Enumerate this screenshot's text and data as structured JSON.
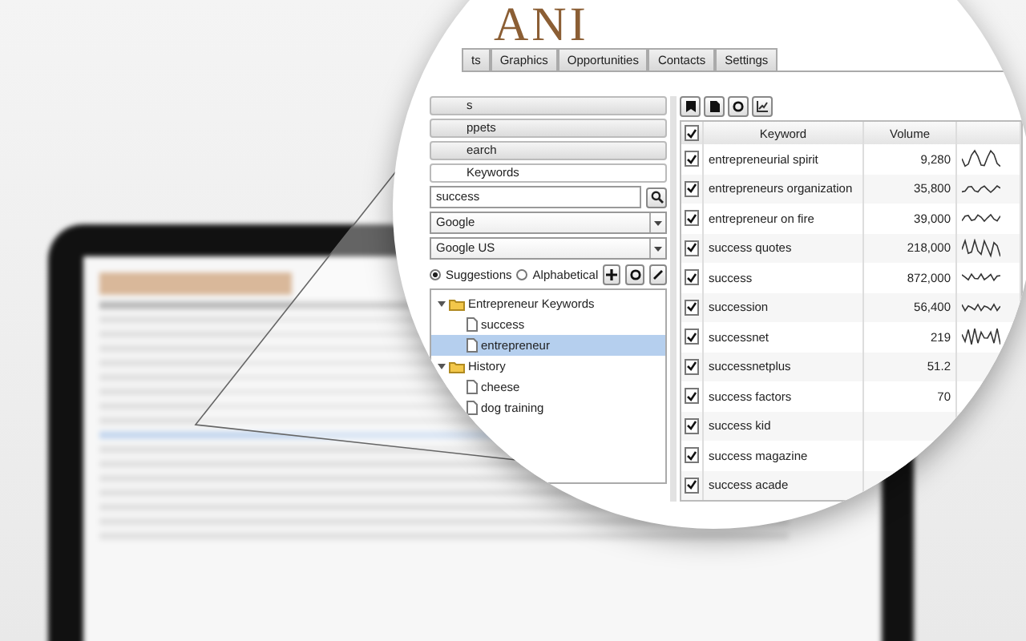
{
  "app": {
    "logo": "ANI",
    "tabs": [
      {
        "label": "ts",
        "selected": false
      },
      {
        "label": "Graphics",
        "selected": false
      },
      {
        "label": "Opportunities",
        "selected": false
      },
      {
        "label": "Contacts",
        "selected": false
      },
      {
        "label": "Settings",
        "selected": false
      }
    ],
    "sections": [
      {
        "label": "s",
        "selected": false
      },
      {
        "label": "ppets",
        "selected": false
      },
      {
        "label": "earch",
        "selected": false
      },
      {
        "label": "Keywords",
        "selected": true
      }
    ],
    "search": {
      "value": "success"
    },
    "engine": {
      "value": "Google"
    },
    "region": {
      "value": "Google US"
    },
    "sort": [
      {
        "label": "Suggestions",
        "selected": true
      },
      {
        "label": "Alphabetical",
        "selected": false
      }
    ],
    "tree": [
      {
        "label": "Entrepreneur Keywords",
        "kind": "folder",
        "expanded": true,
        "selected": false,
        "children": [
          {
            "label": "success",
            "kind": "file",
            "selected": false
          },
          {
            "label": "entrepreneur",
            "kind": "file",
            "selected": true
          }
        ]
      },
      {
        "label": "History",
        "kind": "folder",
        "expanded": true,
        "selected": false,
        "children": [
          {
            "label": "cheese",
            "kind": "file",
            "selected": false
          },
          {
            "label": "dog training",
            "kind": "file",
            "selected": false
          }
        ]
      }
    ],
    "table": {
      "all_checked": true,
      "columns": [
        "Keyword",
        "Volume"
      ],
      "rows": [
        {
          "keyword": "entrepreneurial spirit",
          "volume": "9,280",
          "checked": true
        },
        {
          "keyword": "entrepreneurs organization",
          "volume": "35,800",
          "checked": true
        },
        {
          "keyword": "entrepreneur on fire",
          "volume": "39,000",
          "checked": true
        },
        {
          "keyword": "success quotes",
          "volume": "218,000",
          "checked": true
        },
        {
          "keyword": "success",
          "volume": "872,000",
          "checked": true
        },
        {
          "keyword": "succession",
          "volume": "56,400",
          "checked": true
        },
        {
          "keyword": "successnet",
          "volume": "219",
          "checked": true
        },
        {
          "keyword": "successnetplus",
          "volume": "51.2",
          "checked": true
        },
        {
          "keyword": "success factors",
          "volume": "70",
          "checked": true
        },
        {
          "keyword": "success kid",
          "checked": true
        },
        {
          "keyword": "success magazine",
          "checked": true
        },
        {
          "keyword": "success acade",
          "checked": true
        }
      ]
    }
  }
}
